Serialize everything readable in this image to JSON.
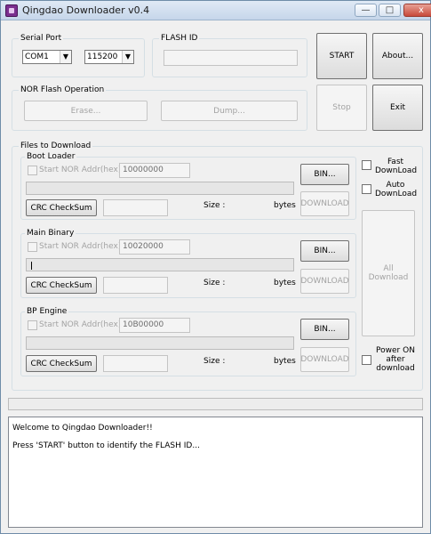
{
  "window": {
    "title": "Qingdao Downloader v0.4",
    "controls": {
      "minimize": "—",
      "maximize": "□",
      "close": "x"
    }
  },
  "serial_port": {
    "legend": "Serial Port",
    "port": "COM1",
    "baud": "115200"
  },
  "flash_id": {
    "legend": "FLASH ID",
    "value": ""
  },
  "nor_flash": {
    "legend": "NOR Flash Operation",
    "erase_label": "Erase...",
    "dump_label": "Dump..."
  },
  "buttons": {
    "start": "START",
    "about": "About...",
    "stop": "Stop",
    "exit": "Exit",
    "all_download": "All Download"
  },
  "files": {
    "legend": "Files to Download",
    "fast_download": "Fast DownLoad",
    "auto_download": "Auto DownLoad",
    "power_on": "Power ON after download",
    "sections": [
      {
        "legend": "Boot Loader",
        "start_nor_label": "Start NOR Addr(hex):",
        "addr": "10000000",
        "bin_label": "BIN...",
        "crc_label": "CRC CheckSum",
        "size_label": "Size :",
        "bytes_label": "bytes",
        "download_label": "DOWNLOAD"
      },
      {
        "legend": "Main Binary",
        "start_nor_label": "Start NOR Addr(hex):",
        "addr": "10020000",
        "bin_label": "BIN...",
        "crc_label": "CRC CheckSum",
        "size_label": "Size :",
        "bytes_label": "bytes",
        "download_label": "DOWNLOAD"
      },
      {
        "legend": "BP Engine",
        "start_nor_label": "Start NOR Addr(hex):",
        "addr": "10B00000",
        "bin_label": "BIN...",
        "crc_label": "CRC CheckSum",
        "size_label": "Size :",
        "bytes_label": "bytes",
        "download_label": "DOWNLOAD"
      }
    ]
  },
  "log": {
    "lines": [
      "Welcome to Qingdao Downloader!!",
      "Press 'START' button to identify the FLASH ID..."
    ]
  }
}
